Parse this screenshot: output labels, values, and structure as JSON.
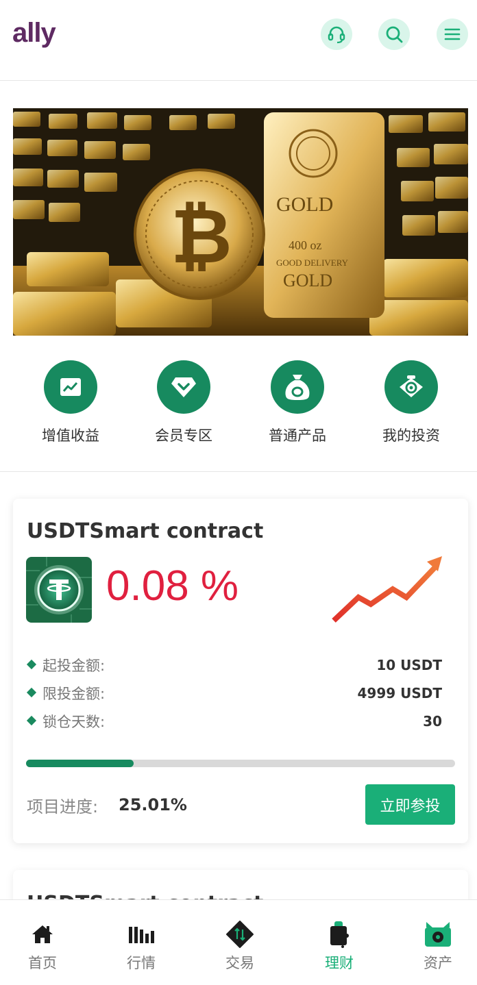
{
  "header": {
    "logo": "ally",
    "icons": [
      "headset-icon",
      "search-icon",
      "menu-icon"
    ]
  },
  "banner": {
    "image": "gold-bars-bitcoin-image",
    "gold_text": "GOLD",
    "weight_text": "400 oz",
    "delivery_text": "GOOD DELIVERY"
  },
  "quick_menu": [
    {
      "label": "增值收益",
      "icon": "chart-trend-icon"
    },
    {
      "label": "会员专区",
      "icon": "diamond-icon"
    },
    {
      "label": "普通产品",
      "icon": "money-bag-icon"
    },
    {
      "label": "我的投资",
      "icon": "wallet-coin-icon"
    }
  ],
  "product": {
    "title": "USDTSmart contract",
    "rate": "0.08 %",
    "rows": [
      {
        "label": "起投金额:",
        "value": "10 USDT"
      },
      {
        "label": "限投金额:",
        "value": "4999 USDT"
      },
      {
        "label": "锁仓天数:",
        "value": "30"
      }
    ],
    "progress_label": "项目进度:",
    "progress_text": "25.01%",
    "progress_fraction": 0.2501,
    "button": "立即参投"
  },
  "product2": {
    "title": "USDTSmart contract"
  },
  "bottom_nav": [
    {
      "label": "首页",
      "icon": "home-icon"
    },
    {
      "label": "行情",
      "icon": "market-bars-icon"
    },
    {
      "label": "交易",
      "icon": "trade-icon"
    },
    {
      "label": "理财",
      "icon": "wallet-icon"
    },
    {
      "label": "资产",
      "icon": "assets-icon"
    }
  ],
  "colors": {
    "brand": "#5e2a62",
    "primary_green": "#178a5f",
    "button_green": "#1aaf78",
    "rate_red": "#e0203f",
    "icon_bg": "#d9f5ea"
  }
}
